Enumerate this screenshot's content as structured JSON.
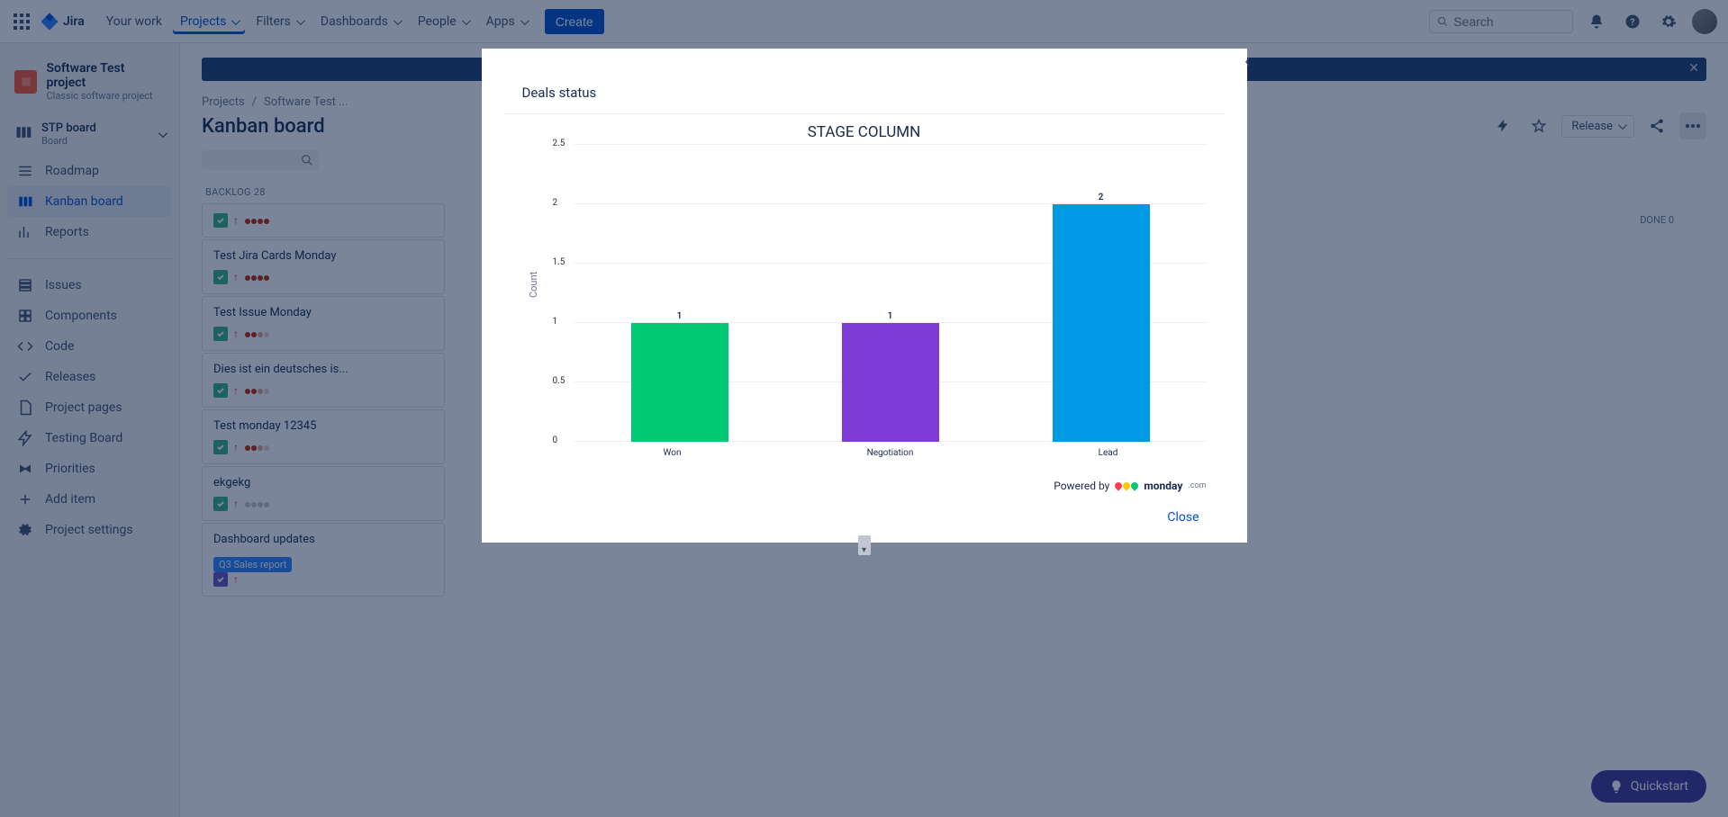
{
  "topnav": {
    "logo_text": "Jira",
    "items": [
      {
        "label": "Your work",
        "active": false,
        "has_chevron": false
      },
      {
        "label": "Projects",
        "active": true,
        "has_chevron": true
      },
      {
        "label": "Filters",
        "active": false,
        "has_chevron": true
      },
      {
        "label": "Dashboards",
        "active": false,
        "has_chevron": true
      },
      {
        "label": "People",
        "active": false,
        "has_chevron": true
      },
      {
        "label": "Apps",
        "active": false,
        "has_chevron": true
      }
    ],
    "create_label": "Create",
    "search_placeholder": "Search"
  },
  "sidebar": {
    "project_name": "Software Test project",
    "project_type": "Classic software project",
    "board_name": "STP board",
    "board_sub": "Board",
    "items": [
      {
        "label": "Roadmap",
        "icon": "roadmap"
      },
      {
        "label": "Kanban board",
        "icon": "board",
        "active": true
      },
      {
        "label": "Reports",
        "icon": "reports"
      }
    ],
    "items2": [
      {
        "label": "Issues",
        "icon": "issues"
      },
      {
        "label": "Components",
        "icon": "components"
      },
      {
        "label": "Code",
        "icon": "code"
      },
      {
        "label": "Releases",
        "icon": "releases"
      },
      {
        "label": "Project pages",
        "icon": "pages"
      },
      {
        "label": "Testing Board",
        "icon": "bolt"
      },
      {
        "label": "Priorities",
        "icon": "priorities"
      },
      {
        "label": "Add item",
        "icon": "plus"
      },
      {
        "label": "Project settings",
        "icon": "gear"
      }
    ]
  },
  "breadcrumbs": [
    "Projects",
    "Software Test ..."
  ],
  "page_title": "Kanban board",
  "release_label": "Release",
  "columns": {
    "backlog": {
      "title": "BACKLOG",
      "count": "28"
    },
    "done": {
      "title": "DONE",
      "count": "0"
    }
  },
  "cards": [
    {
      "title": "",
      "type": "green",
      "dots": "full"
    },
    {
      "title": "Test Jira Cards Monday",
      "type": "green",
      "dots": "full"
    },
    {
      "title": "Test Issue Monday",
      "type": "green",
      "dots": "faded3"
    },
    {
      "title": "Dies ist ein deutsches is...",
      "type": "green",
      "dots": "faded2"
    },
    {
      "title": "Test monday 12345",
      "type": "green",
      "dots": "faded2"
    },
    {
      "title": "ekgekg",
      "type": "green",
      "dots": "grey"
    },
    {
      "title": "Dashboard updates",
      "type": "purple",
      "dots": "none",
      "lozenge": "Q3 Sales report"
    }
  ],
  "quickstart_label": "Quickstart",
  "modal": {
    "title": "Deals status",
    "powered_by": "Powered by",
    "monday_text": "monday",
    "monday_suffix": ".com",
    "close_label": "Close"
  },
  "chart_data": {
    "type": "bar",
    "title": "STAGE COLUMN",
    "ylabel": "Count",
    "xlabel": "",
    "ylim": [
      0,
      2.5
    ],
    "yticks": [
      0,
      0.5,
      1,
      1.5,
      2,
      2.5
    ],
    "categories": [
      "Won",
      "Negotiation",
      "Lead"
    ],
    "values": [
      1,
      1,
      2
    ],
    "colors": [
      "#00C875",
      "#7E3BD6",
      "#0099E5"
    ]
  }
}
